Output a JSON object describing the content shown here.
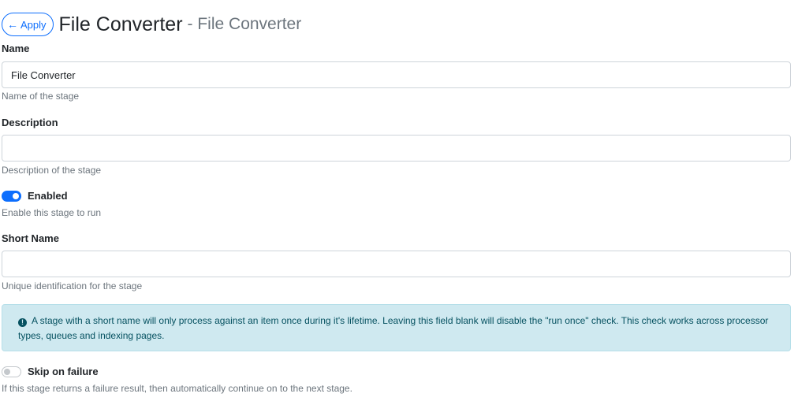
{
  "header": {
    "apply_label": "Apply",
    "title": "File Converter",
    "subtitle": "- File Converter"
  },
  "form": {
    "name": {
      "label": "Name",
      "value": "File Converter",
      "help": "Name of the stage"
    },
    "description": {
      "label": "Description",
      "value": "",
      "help": "Description of the stage"
    },
    "enabled": {
      "label": "Enabled",
      "checked": true,
      "help": "Enable this stage to run"
    },
    "short_name": {
      "label": "Short Name",
      "value": "",
      "help": "Unique identification for the stage"
    },
    "alert": {
      "icon": "info-circle-icon",
      "text": "A stage with a short name will only process against an item once during it's lifetime. Leaving this field blank will disable the \"run once\" check. This check works across processor types, queues and indexing pages."
    },
    "skip_on_failure": {
      "label": "Skip on failure",
      "checked": false,
      "help": "If this stage returns a failure result, then automatically continue on to the next stage."
    }
  },
  "colors": {
    "accent": "#0d6efd",
    "muted_text": "#6c757d",
    "alert_bg": "#cfe9f0",
    "alert_text": "#055160"
  }
}
